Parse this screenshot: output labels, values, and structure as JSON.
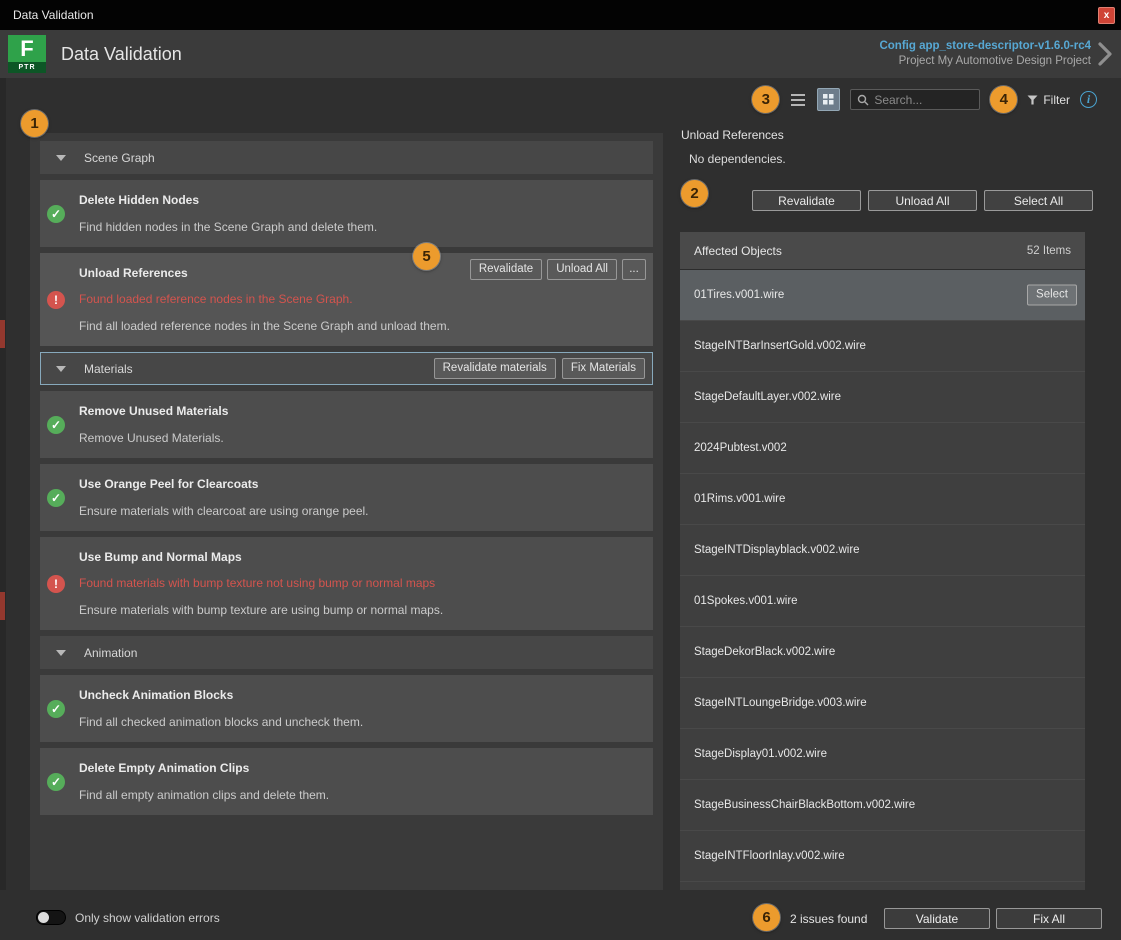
{
  "titlebar": {
    "title": "Data Validation",
    "close_label": "x"
  },
  "header": {
    "app_title": "Data Validation",
    "logo_letter": "F",
    "logo_badge": "PTR",
    "config_name": "Config app_store-descriptor-v1.6.0-rc4",
    "project_name": "Project My Automotive Design Project"
  },
  "toolbar": {
    "search_placeholder": "Search...",
    "filter_label": "Filter"
  },
  "annotations": {
    "a1": "1",
    "a2": "2",
    "a3": "3",
    "a4": "4",
    "a5": "5",
    "a6": "6"
  },
  "checks": {
    "sections": [
      {
        "title": "Scene Graph",
        "items": [
          {
            "status": "ok",
            "title": "Delete Hidden Nodes",
            "desc": "Find hidden nodes in the Scene Graph and delete them."
          },
          {
            "status": "error",
            "title": "Unload References",
            "error": "Found loaded reference nodes in the Scene Graph.",
            "desc": "Find all loaded reference nodes in the Scene Graph and unload them.",
            "buttons": [
              "Revalidate",
              "Unload All",
              "..."
            ]
          }
        ]
      },
      {
        "title": "Materials",
        "header_buttons": [
          "Revalidate materials",
          "Fix Materials"
        ],
        "items": [
          {
            "status": "ok",
            "title": "Remove Unused Materials",
            "desc": "Remove Unused Materials."
          },
          {
            "status": "ok",
            "title": "Use Orange Peel for Clearcoats",
            "desc": "Ensure materials with clearcoat are using orange peel."
          },
          {
            "status": "error",
            "title": "Use Bump and Normal Maps",
            "error": "Found materials with bump texture not using bump or normal maps",
            "desc": "Ensure materials with bump texture are using bump or normal maps."
          }
        ]
      },
      {
        "title": "Animation",
        "items": [
          {
            "status": "ok",
            "title": "Uncheck Animation Blocks",
            "desc": "Find all checked animation blocks and uncheck them."
          },
          {
            "status": "ok",
            "title": "Delete Empty Animation Clips",
            "desc": "Find all empty animation clips and delete them."
          }
        ]
      }
    ],
    "footer_toggle_label": "Only show validation errors"
  },
  "details": {
    "title": "Unload References",
    "subtitle": "No dependencies.",
    "buttons": [
      "Revalidate",
      "Unload All",
      "Select All"
    ],
    "table": {
      "header_left": "Affected Objects",
      "header_right": "52 Items",
      "select_button": "Select",
      "rows": [
        "01Tires.v001.wire",
        "StageINTBarInsertGold.v002.wire",
        "StageDefaultLayer.v002.wire",
        "2024Pubtest.v002",
        "01Rims.v001.wire",
        "StageINTDisplayblack.v002.wire",
        "01Spokes.v001.wire",
        "StageDekorBlack.v002.wire",
        "StageINTLoungeBridge.v003.wire",
        "StageDisplay01.v002.wire",
        "StageBusinessChairBlackBottom.v002.wire",
        "StageINTFloorInlay.v002.wire"
      ]
    }
  },
  "footer": {
    "issues_text": "2 issues found",
    "validate_label": "Validate",
    "fix_all_label": "Fix All"
  },
  "colors": {
    "accent": "#ec9b2d",
    "error": "#d4544e",
    "ok": "#56ad5a",
    "link": "#57a8d4",
    "info": "#4aa3cf"
  }
}
